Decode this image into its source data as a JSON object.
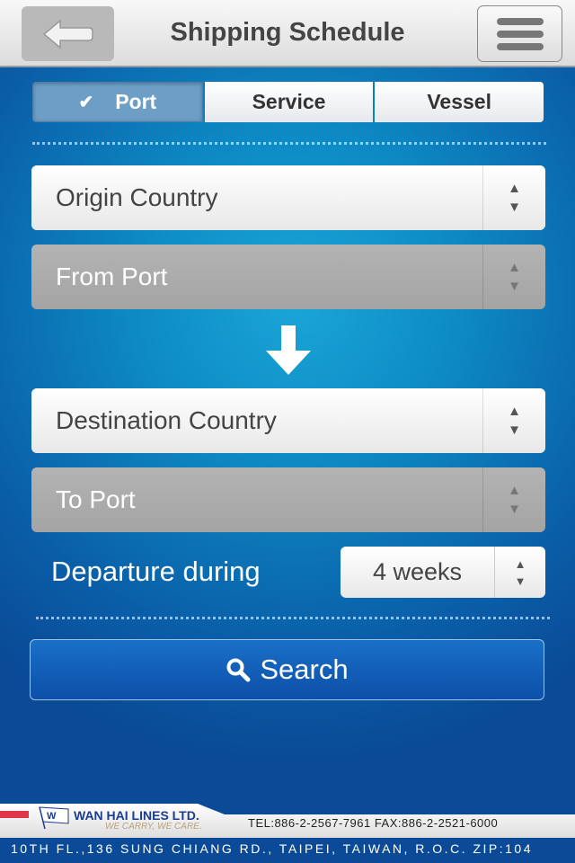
{
  "header": {
    "title": "Shipping Schedule",
    "back_icon": "arrow-left-icon",
    "menu_icon": "hamburger-icon"
  },
  "tabs": [
    {
      "label": "Port",
      "active": true
    },
    {
      "label": "Service",
      "active": false
    },
    {
      "label": "Vessel",
      "active": false
    }
  ],
  "form": {
    "origin_country": "Origin Country",
    "from_port": "From Port",
    "destination_country": "Destination Country",
    "to_port": "To Port",
    "departure_label": "Departure during",
    "departure_value": "4 weeks",
    "search_label": "Search"
  },
  "footer": {
    "company": "WAN HAI LINES LTD.",
    "slogan": "WE CARRY, WE CARE.",
    "contact": "TEL:886-2-2567-7961 FAX:886-2-2521-6000",
    "address": "10TH FL.,136 SUNG CHIANG RD., TAIPEI, TAIWAN, R.O.C. ZIP:104"
  }
}
